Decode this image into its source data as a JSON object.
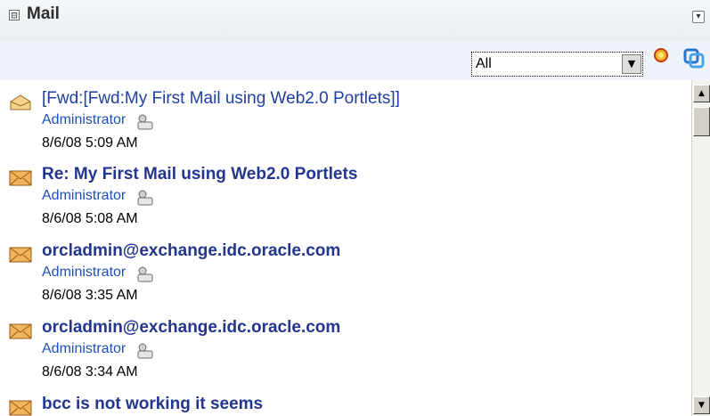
{
  "portlet": {
    "title": "Mail",
    "collapse_glyph": "⊟",
    "menu_glyph": "▾"
  },
  "toolbar": {
    "filter": {
      "selected": "All",
      "arrow": "▼"
    },
    "new_icon": "new-mail-icon",
    "refresh_icon": "refresh-icon"
  },
  "messages": [
    {
      "subject": "[Fwd:[Fwd:My First Mail using Web2.0 Portlets]]",
      "sender": "Administrator",
      "date": "8/6/08 5:09 AM",
      "read": true
    },
    {
      "subject": "Re: My First Mail using Web2.0 Portlets",
      "sender": "Administrator",
      "date": "8/6/08 5:08 AM",
      "read": false
    },
    {
      "subject": "orcladmin@exchange.idc.oracle.com",
      "sender": "Administrator",
      "date": "8/6/08 3:35 AM",
      "read": false
    },
    {
      "subject": "orcladmin@exchange.idc.oracle.com",
      "sender": "Administrator",
      "date": "8/6/08 3:34 AM",
      "read": false
    },
    {
      "subject": "bcc is not working it seems",
      "sender": "",
      "date": "",
      "read": false
    }
  ],
  "scrollbar": {
    "up": "▲",
    "down": "▼"
  },
  "colors": {
    "unread_subject": "#23358e",
    "read_subject": "#2040a0",
    "sender": "#1e50b4",
    "header_bg": "#e9eef3"
  }
}
